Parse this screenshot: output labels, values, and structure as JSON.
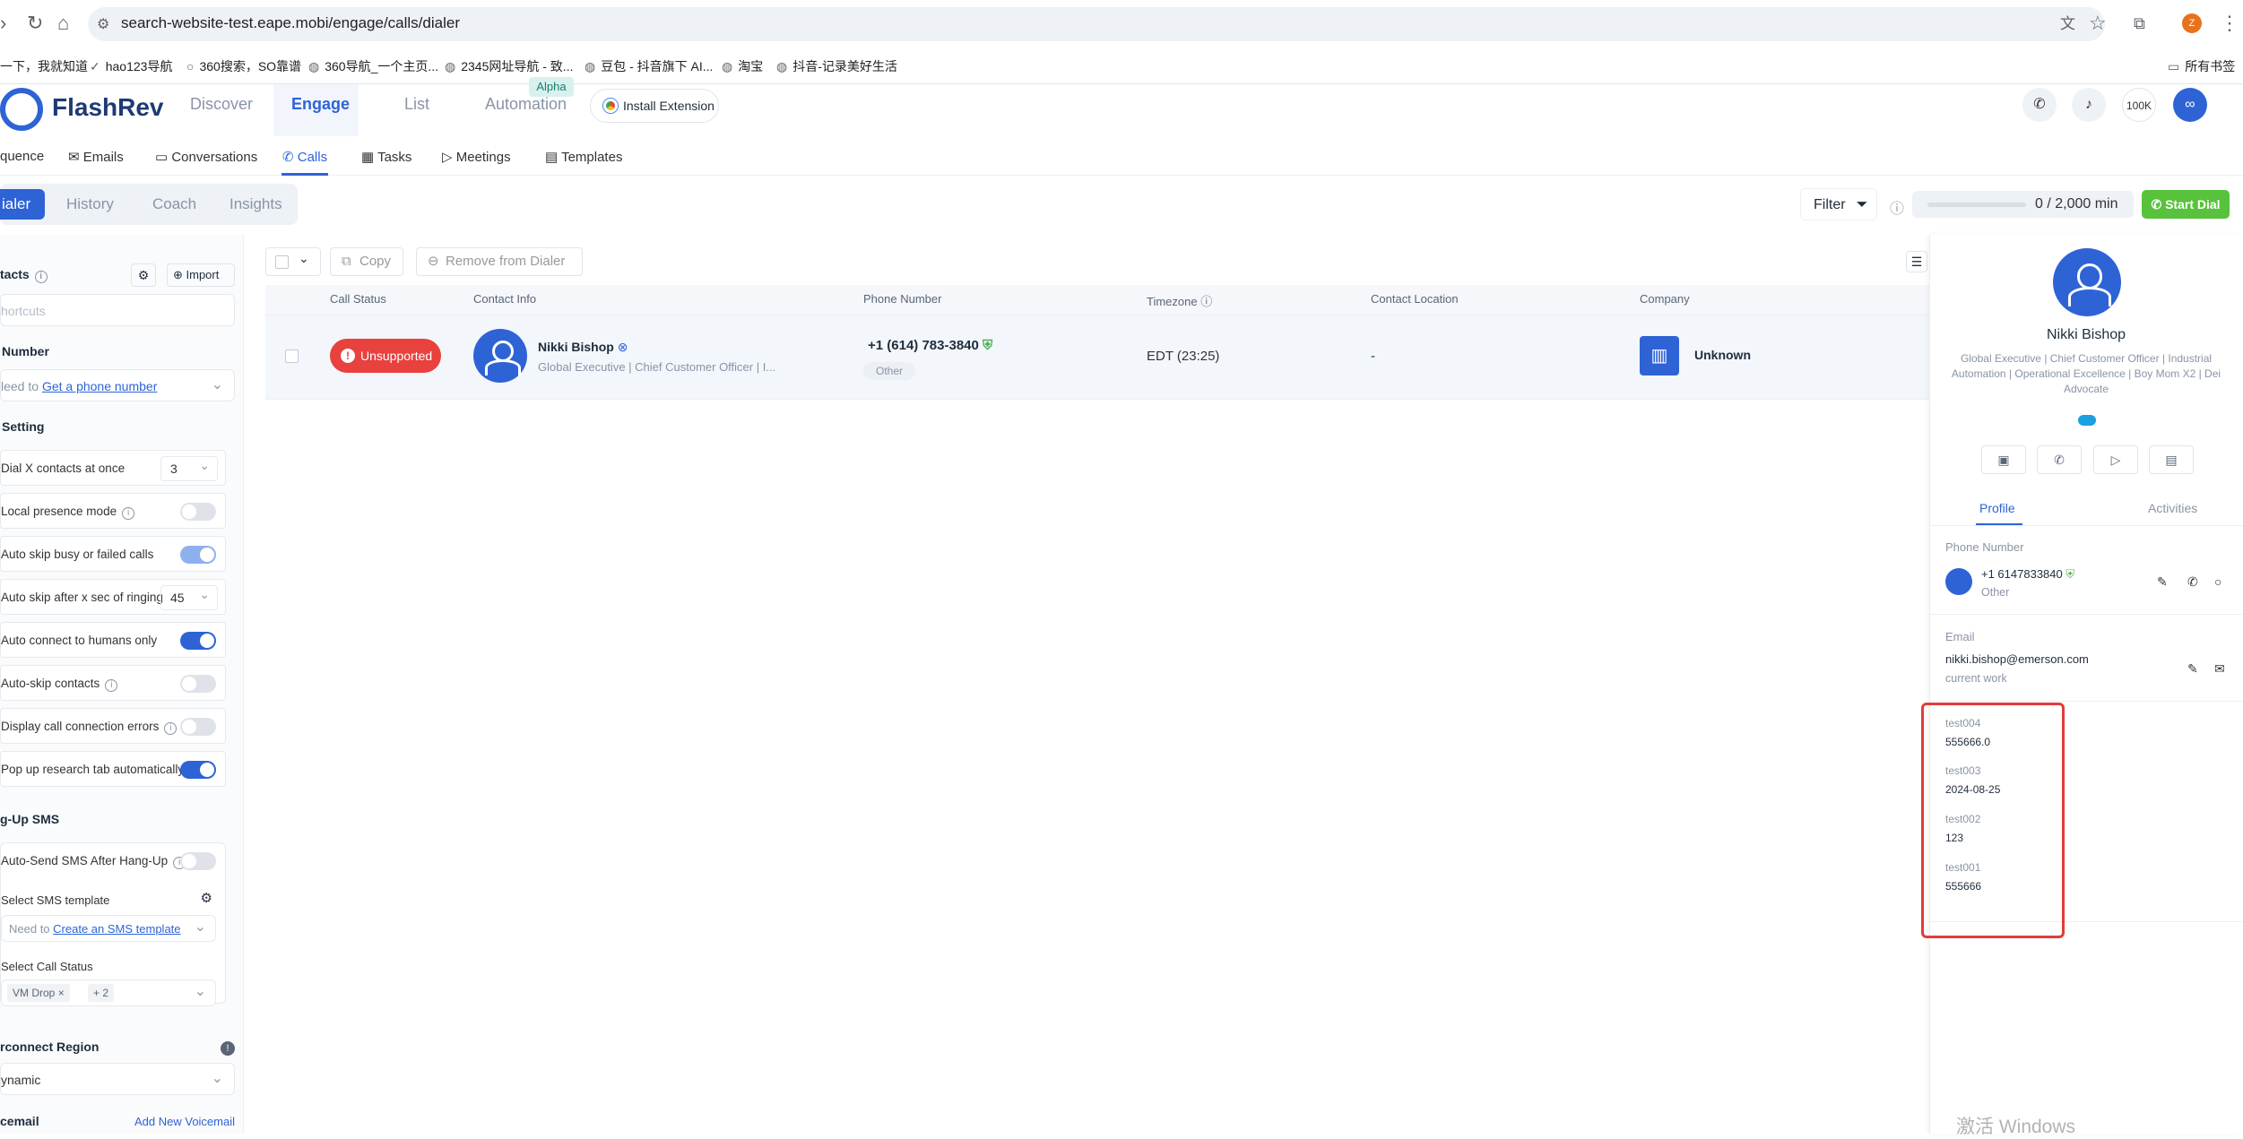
{
  "browser": {
    "url": "search-website-test.eape.mobi/engage/calls/dialer",
    "bookmarks": [
      "一下，我就知道",
      "hao123导航",
      "360搜索，SO靠谱",
      "360导航_一个主页...",
      "2345网址导航 - 致...",
      "豆包 - 抖音旗下 AI...",
      "淘宝",
      "抖音-记录美好生活"
    ],
    "all_bookmarks": "所有书签",
    "profile_letter": "Z"
  },
  "header": {
    "brand": "FlashRev",
    "nav": [
      "Discover",
      "Engage",
      "List",
      "Automation"
    ],
    "alpha_badge": "Alpha",
    "install_extension": "Install Extension",
    "credits": "100K"
  },
  "subnav": [
    "quence",
    "Emails",
    "Conversations",
    "Calls",
    "Tasks",
    "Meetings",
    "Templates"
  ],
  "modes": [
    "ialer",
    "History",
    "Coach",
    "Insights"
  ],
  "controls": {
    "filter": "Filter",
    "usage": "0 / 2,000 min",
    "start_dial": "Start Dial"
  },
  "left": {
    "contacts_title": "tacts",
    "import": "Import",
    "shortcuts_placeholder": "hortcuts",
    "number_title": "Number",
    "need_to": "leed to",
    "get_phone": "Get a phone number",
    "setting_title": "Setting",
    "dial_x": "Dial X contacts at once",
    "dial_x_value": "3",
    "local_presence": "Local presence mode",
    "auto_skip_busy": "Auto skip busy or failed calls",
    "auto_skip_ringing": "Auto skip after x sec of ringing",
    "ringing_value": "45",
    "auto_connect": "Auto connect to humans only",
    "auto_skip_contacts": "Auto-skip contacts",
    "display_errors": "Display call connection errors",
    "popup_research": "Pop up research tab automatically",
    "hangup_title": "g-Up SMS",
    "auto_send_sms": "Auto-Send SMS After Hang-Up",
    "select_sms": "Select SMS template",
    "need_to_2": "Need to",
    "create_sms": "Create an SMS template",
    "select_call_status": "Select Call Status",
    "vm_drop": "VM Drop",
    "plus_two": "+ 2",
    "region_title": "rconnect Region",
    "region_value": "ynamic",
    "voicemail_title": "cemail",
    "add_voicemail": "Add New Voicemail"
  },
  "table": {
    "copy": "Copy",
    "remove": "Remove from Dialer",
    "columns": [
      "Call Status",
      "Contact Info",
      "Phone Number",
      "Timezone",
      "Contact Location",
      "Company"
    ],
    "row": {
      "status": "Unsupported",
      "name": "Nikki Bishop",
      "title": "Global Executive | Chief Customer Officer | I...",
      "phone": "+1 (614) 783-3840",
      "phone_type": "Other",
      "timezone": "EDT (23:25)",
      "location": "-",
      "company": "Unknown"
    }
  },
  "profile": {
    "name": "Nikki Bishop",
    "headline": "Global Executive | Chief Customer Officer | Industrial Automation | Operational Excellence | Boy Mom X2 | Dei Advocate",
    "tabs": [
      "Profile",
      "Activities"
    ],
    "phone_label": "Phone Number",
    "phone": "+1 6147833840",
    "phone_type": "Other",
    "email_label": "Email",
    "email": "nikki.bishop@emerson.com",
    "email_type": "current work",
    "custom_fields": [
      {
        "label": "test004",
        "value": "555666.0"
      },
      {
        "label": "test003",
        "value": "2024-08-25"
      },
      {
        "label": "test002",
        "value": "123"
      },
      {
        "label": "test001",
        "value": "555666"
      }
    ]
  },
  "watermark": "激活 Windows"
}
